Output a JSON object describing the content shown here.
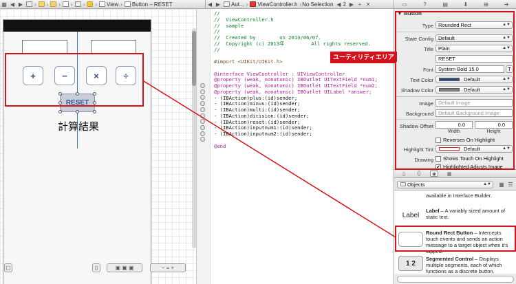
{
  "jumpbar_left": {
    "crumbs": [
      "View",
      "Button – RESET"
    ]
  },
  "jumpbar_mid": {
    "crumbs": [
      "Aut...",
      "ViewController.h",
      "No Selection"
    ],
    "counter": "2"
  },
  "storyboard": {
    "buttons": [
      "+",
      "−",
      "×",
      "÷"
    ],
    "reset_label": "RESET",
    "answer_label": "計算結果"
  },
  "code": {
    "lines": [
      {
        "cls": "c-com",
        "text": "//"
      },
      {
        "cls": "c-com",
        "text": "//  ViewController.h"
      },
      {
        "cls": "c-com",
        "text": "//  sample"
      },
      {
        "cls": "c-com",
        "text": "//"
      },
      {
        "cls": "c-com",
        "text": "//  Created by        on 2013/06/07."
      },
      {
        "cls": "c-com",
        "text": "//  Copyright (c) 2013年         All rights reserved."
      },
      {
        "cls": "c-com",
        "text": "//"
      },
      {
        "cls": "",
        "text": ""
      },
      {
        "cls": "c-pre",
        "text": "#import <UIKit/UIKit.h>"
      },
      {
        "cls": "",
        "text": ""
      },
      {
        "cls": "c-kw",
        "text": "@interface ViewController : UIViewController"
      },
      {
        "cls": "c-kw",
        "text": "@property (weak, nonatomic) IBOutlet UITextField *num1;"
      },
      {
        "cls": "c-kw",
        "text": "@property (weak, nonatomic) IBOutlet UITextField *num2;"
      },
      {
        "cls": "c-kw",
        "text": "@property (weak, nonatomic) IBOutlet UILabel *answer;"
      },
      {
        "cls": "",
        "text": "- (IBAction)plus:(id)sender;"
      },
      {
        "cls": "",
        "text": "- (IBAction)minus:(id)sender;"
      },
      {
        "cls": "",
        "text": "- (IBAction)multi:(id)sender;"
      },
      {
        "cls": "",
        "text": "- (IBAction)dicision:(id)sender;"
      },
      {
        "cls": "",
        "text": "- (IBAction)reset:(id)sender;"
      },
      {
        "cls": "",
        "text": "- (IBAction)inputnum1:(id)sender;"
      },
      {
        "cls": "",
        "text": "- (IBAction)inputnum2:(id)sender;"
      },
      {
        "cls": "",
        "text": ""
      },
      {
        "cls": "c-kw",
        "text": "@end"
      }
    ]
  },
  "inspector": {
    "section_title": "Button",
    "type_label": "Type",
    "type_value": "Rounded Rect",
    "state_config_label": "State Config",
    "state_config_value": "Default",
    "title_label": "Title",
    "title_value": "Plain",
    "title_text": "RESET",
    "font_label": "Font",
    "font_value": "System Bold 15.0",
    "text_color_label": "Text Color",
    "text_color_value": "Default",
    "shadow_color_label": "Shadow Color",
    "shadow_color_value": "Default",
    "image_label": "Image",
    "image_placeholder": "Default Image",
    "background_label": "Background",
    "background_placeholder": "Default Background Image",
    "shadow_offset_label": "Shadow Offset",
    "shadow_offset_width": "0.0",
    "shadow_offset_height": "0.0",
    "width_label": "Width",
    "height_label": "Height",
    "reverses_label": "Reverses On Highlight",
    "highlight_tint_label": "Highlight Tint",
    "highlight_tint_value": "Default",
    "drawing_label": "Drawing",
    "shows_touch_label": "Shows Touch On Highlight",
    "highlighted_adjusts_label": "Highlighted Adjusts Image"
  },
  "annotation": {
    "utility_area_label": "ユーティリティエリア"
  },
  "library": {
    "filter_value": "Objects",
    "items": [
      {
        "icon": "",
        "name": "",
        "desc": "available in Interface Builder."
      },
      {
        "icon": "Label",
        "name": "Label",
        "desc": " – A variably sized amount of static text."
      },
      {
        "icon": "",
        "name": "Round Rect Button",
        "desc": " – Intercepts touch events and sends an action message to a target object when it's tapped."
      },
      {
        "icon": "1 2",
        "name": "Segmented Control",
        "desc": " – Displays multiple segments, each of which functions as a discrete button."
      }
    ]
  },
  "colors": {
    "accent_red": "#d5121b",
    "guide_blue": "#2f7bd6",
    "button_text": "#324f85"
  }
}
